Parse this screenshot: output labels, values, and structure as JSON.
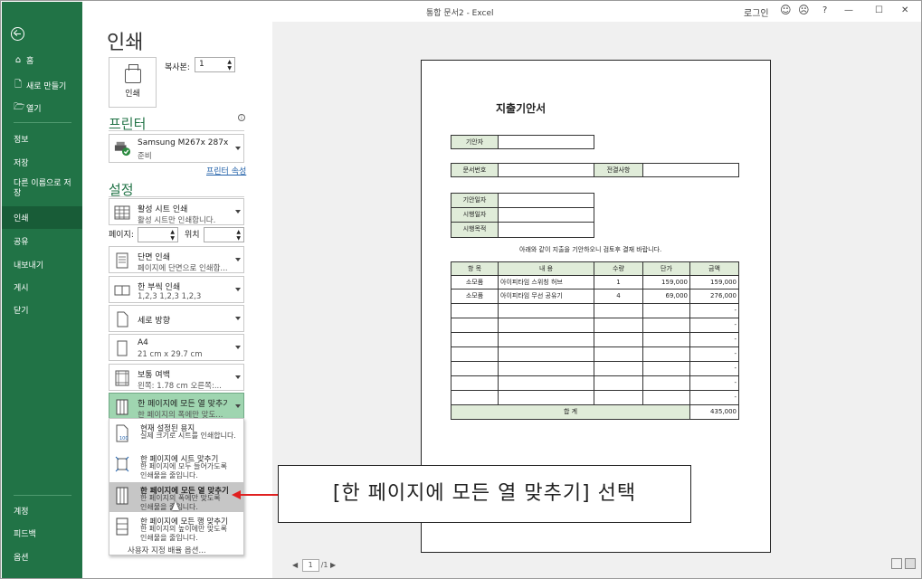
{
  "window": {
    "title": "통합 문서2  -  Excel",
    "login": "로그인",
    "help": "?",
    "minimize": "—",
    "maximize": "☐",
    "close": "✕",
    "smile": "☺",
    "frown": "☹"
  },
  "sidebar": {
    "top": [
      {
        "label": "홈",
        "icon": "⌂"
      },
      {
        "label": "새로 만들기",
        "icon": "🗋"
      },
      {
        "label": "열기",
        "icon": "🗁"
      }
    ],
    "items": [
      "정보",
      "저장",
      "다른 이름으로 저장",
      "인쇄",
      "공유",
      "내보내기",
      "게시",
      "닫기"
    ],
    "bottom": [
      "계정",
      "피드백",
      "옵션"
    ]
  },
  "print": {
    "heading": "인쇄",
    "button_label": "인쇄",
    "copies_label": "복사본:",
    "copies_value": "1",
    "printer_heading": "프린터",
    "printer_name": "Samsung M267x 287x Se...",
    "printer_status": "준비",
    "printer_props": "프린터 속성",
    "settings_heading": "설정",
    "pages_label": "페이지:",
    "to_label": "위치",
    "settings": [
      {
        "t1": "활성 시트 인쇄",
        "t2": "활성 시트만 인쇄합니다."
      },
      {
        "t1": "단면 인쇄",
        "t2": "페이지에 단면으로 인쇄합..."
      },
      {
        "t1": "한 부씩 인쇄",
        "t2": "1,2,3     1,2,3     1,2,3"
      },
      {
        "t1": "세로 방향",
        "t2": ""
      },
      {
        "t1": "A4",
        "t2": "21 cm x 29.7 cm"
      },
      {
        "t1": "보통 여백",
        "t2": "왼쪽:  1.78 cm     오른쪽:..."
      },
      {
        "t1": "한 페이지에 모든 열 맞추기",
        "t2": "한 페이지의 폭에만 맞도..."
      }
    ],
    "menu": [
      {
        "a": "현재 설정된 용지",
        "b": "실제 크기로 시트를 인쇄합니다."
      },
      {
        "a": "한 페이지에 시트 맞추기",
        "b": "한 페이지에 모두 들어가도록",
        "c": "인쇄물을 줄입니다."
      },
      {
        "a": "한 페이지에 모든 열 맞추기",
        "b": "한 페이지의 폭에만 맞도록",
        "c": "인쇄물을 줄입니다."
      },
      {
        "a": "한 페이지에 모든 행 맞추기",
        "b": "한 페이지의 높이에만 맞도록",
        "c": "인쇄물을 줄입니다."
      }
    ],
    "custom_label": "사용자 지정 배율 옵션..."
  },
  "preview": {
    "title": "지출기안서",
    "f_drafter": "기안자",
    "f_docno": "문서번호",
    "f_approval": "전결사항",
    "f_date1": "기안일자",
    "f_date2": "시행일자",
    "f_purpose": "시행목적",
    "notice": "아래와 같이 지출을 기안하오니 검토후 결재 바랍니다.",
    "headers": [
      "항 목",
      "내 용",
      "수량",
      "단가",
      "금액"
    ],
    "rows": [
      [
        "소모품",
        "아이피타임 스위칭 허브",
        "1",
        "159,000",
        "159,000"
      ],
      [
        "소모품",
        "아이피타임 무선 공유기",
        "4",
        "69,000",
        "276,000"
      ]
    ],
    "dash": "-",
    "total_label": "합 계",
    "total": "435,000",
    "page_current": "1",
    "page_total": "/1"
  },
  "callout": "[한 페이지에 모든 열 맞추기] 선택"
}
